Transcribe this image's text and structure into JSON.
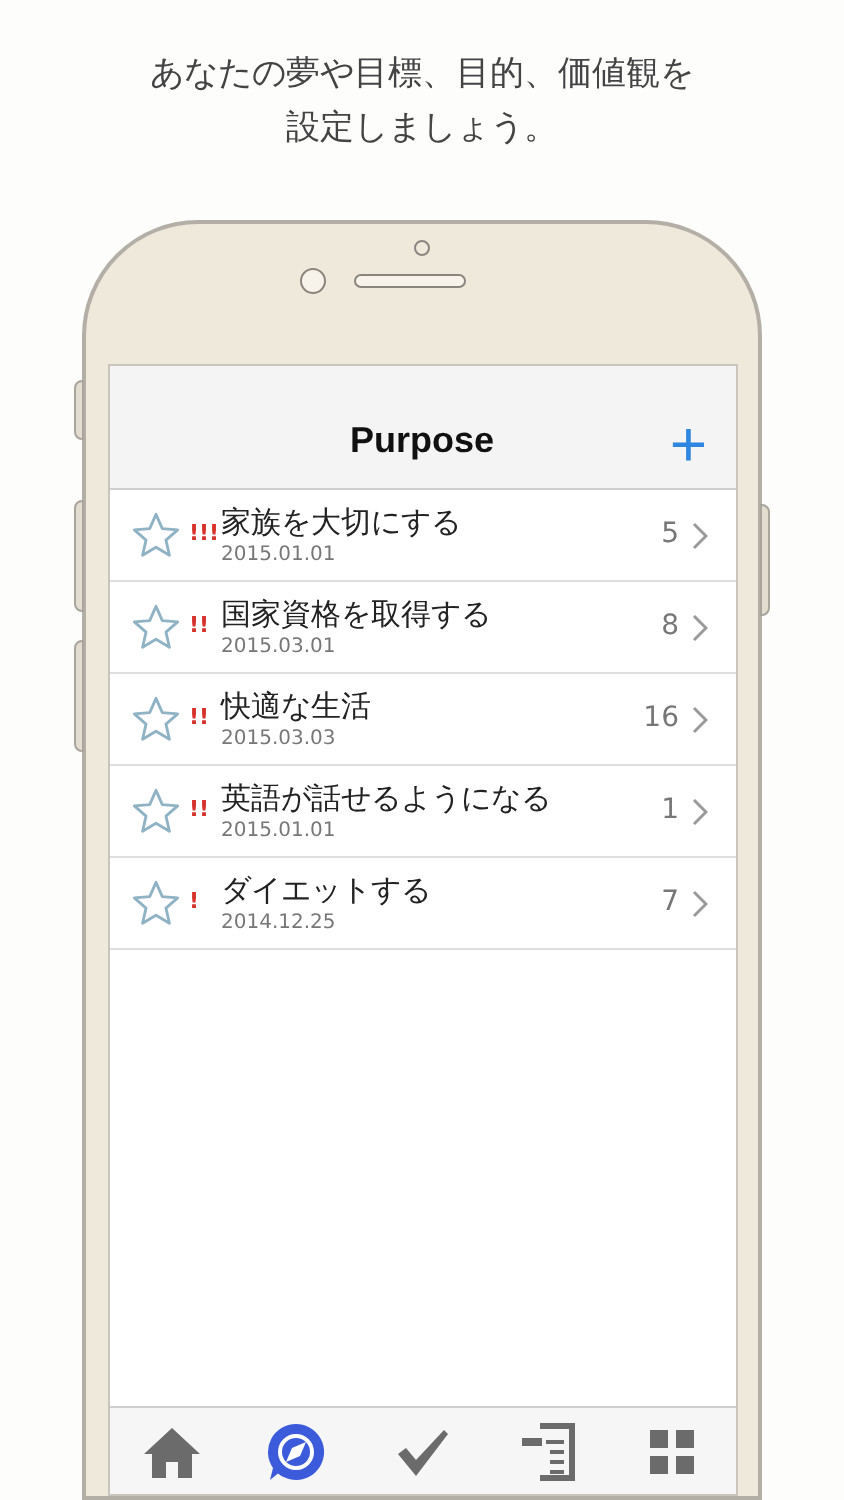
{
  "caption": [
    "あなたの夢や目標、目的、価値観を",
    "設定しましょう。"
  ],
  "nav": {
    "title": "Purpose",
    "add": "+"
  },
  "rows": [
    {
      "title": "家族を大切にする",
      "date": "2015.01.01",
      "priority": "!!!",
      "count": "5"
    },
    {
      "title": "国家資格を取得する",
      "date": "2015.03.01",
      "priority": "!!",
      "count": "8"
    },
    {
      "title": "快適な生活",
      "date": "2015.03.03",
      "priority": "!!",
      "count": "16"
    },
    {
      "title": "英語が話せるようになる",
      "date": "2015.01.01",
      "priority": "!!",
      "count": "1"
    },
    {
      "title": "ダイエットする",
      "date": "2014.12.25",
      "priority": "!",
      "count": "7"
    }
  ],
  "tabs": [
    {
      "kind": "home",
      "selected": false
    },
    {
      "kind": "compass",
      "selected": true
    },
    {
      "kind": "check",
      "selected": false
    },
    {
      "kind": "outline",
      "selected": false
    },
    {
      "kind": "grid",
      "selected": false
    }
  ]
}
